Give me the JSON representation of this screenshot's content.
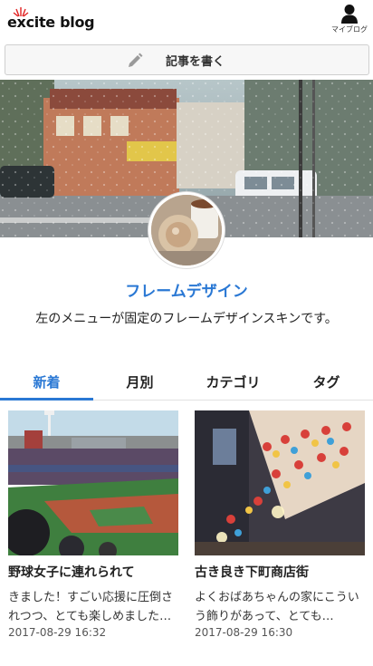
{
  "header": {
    "logo_text": "excite blog",
    "myblog_label": "マイブログ"
  },
  "write_button": {
    "label": "記事を書く"
  },
  "profile": {
    "title": "フレームデザイン",
    "description": "左のメニューが固定のフレームデザインスキンです。"
  },
  "tabs": [
    {
      "label": "新着",
      "active": true
    },
    {
      "label": "月別",
      "active": false
    },
    {
      "label": "カテゴリ",
      "active": false
    },
    {
      "label": "タグ",
      "active": false
    }
  ],
  "posts": [
    {
      "title": "野球女子に連れられて",
      "excerpt": "きました！すごい応援に圧倒されつつ、とても楽しめました…",
      "date": "2017-08-29 16:32"
    },
    {
      "title": "古き良き下町商店街",
      "excerpt": "よくおばあちゃんの家にこういう飾りがあって、とても…",
      "date": "2017-08-29 16:30"
    }
  ],
  "colors": {
    "accent": "#2a78d4"
  }
}
